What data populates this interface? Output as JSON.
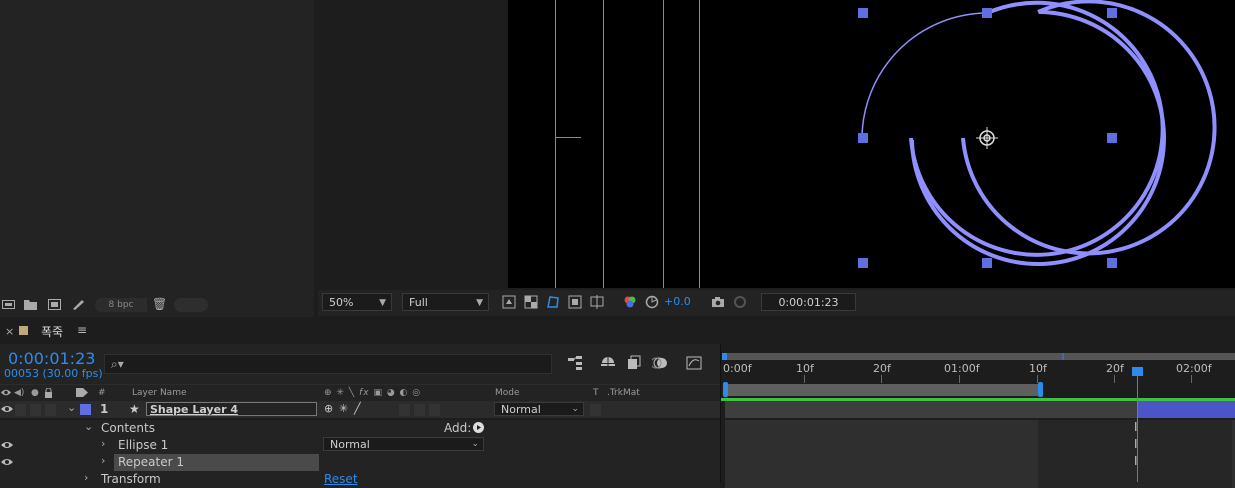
{
  "project": {
    "footer": {
      "bpc": "8 bpc"
    }
  },
  "viewer": {
    "zoom": "50%",
    "resolution": "Full",
    "exposure": "+0.0",
    "time": "0:00:01:23"
  },
  "timeline": {
    "tab_name": "폭죽",
    "current_time": "0:00:01:23",
    "frames": "00053 (30.00 fps)",
    "columns": {
      "hash": "#",
      "layer_name": "Layer Name",
      "mode": "Mode",
      "t": "T",
      "trkmat": ".TrkMat"
    },
    "ruler": [
      "0:00f",
      "10f",
      "20f",
      "01:00f",
      "10f",
      "20f",
      "02:00f"
    ],
    "layer": {
      "index": "1",
      "name": "Shape Layer 4",
      "mode": "Normal",
      "label_color": "#5f6ee0"
    },
    "contents": {
      "label": "Contents",
      "add_label": "Add:"
    },
    "ellipse": {
      "label": "Ellipse 1",
      "mode": "Normal"
    },
    "repeater": {
      "label": "Repeater 1"
    },
    "transform": {
      "label": "Transform",
      "reset": "Reset"
    }
  },
  "colors": {
    "accent": "#2d8ceb",
    "shape_stroke": "#8f8fff",
    "handle": "#5f6ee0",
    "green_bar": "#3fc13f"
  }
}
